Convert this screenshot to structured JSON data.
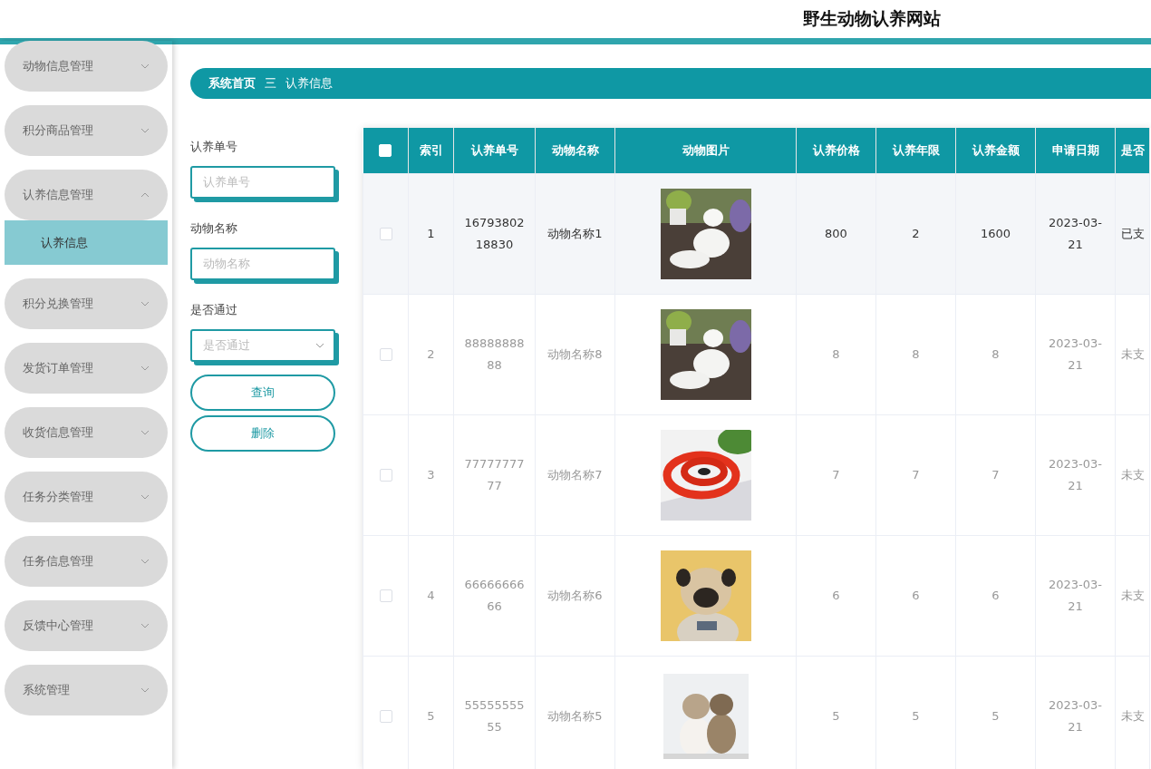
{
  "header": {
    "title": "野生动物认养网站"
  },
  "sidebar": {
    "items": [
      {
        "label": "动物信息管理",
        "expanded": false
      },
      {
        "label": "积分商品管理",
        "expanded": false
      },
      {
        "label": "认养信息管理",
        "expanded": true,
        "children": [
          {
            "label": "认养信息",
            "selected": true
          }
        ]
      },
      {
        "label": "积分兑换管理",
        "expanded": false
      },
      {
        "label": "发货订单管理",
        "expanded": false
      },
      {
        "label": "收货信息管理",
        "expanded": false
      },
      {
        "label": "任务分类管理",
        "expanded": false
      },
      {
        "label": "任务信息管理",
        "expanded": false
      },
      {
        "label": "反馈中心管理",
        "expanded": false
      },
      {
        "label": "系统管理",
        "expanded": false
      }
    ]
  },
  "breadcrumb": {
    "home": "系统首页",
    "separator": "三",
    "current": "认养信息"
  },
  "filters": [
    {
      "kind": "input",
      "label": "认养单号",
      "placeholder": "认养单号"
    },
    {
      "kind": "input",
      "label": "动物名称",
      "placeholder": "动物名称"
    },
    {
      "kind": "select",
      "label": "是否通过",
      "placeholder": "是否通过"
    }
  ],
  "buttons": [
    "查询",
    "删除"
  ],
  "table": {
    "select_all_checked": false,
    "columns": [
      "索引",
      "认养单号",
      "动物名称",
      "动物图片",
      "认养价格",
      "认养年限",
      "认养金额",
      "申请日期",
      "是否"
    ],
    "rows": [
      {
        "highlighted": true,
        "checked": false,
        "cells": [
          "1",
          "16793802 18830",
          "动物名称1",
          {
            "kind": "picture"
          },
          "800",
          "2",
          "1600",
          "2023-03- 21",
          "已支"
        ]
      },
      {
        "highlighted": false,
        "checked": false,
        "cells": [
          "2",
          "88888888 88",
          "动物名称8",
          {
            "kind": "picture"
          },
          "8",
          "8",
          "8",
          "2023-03- 21",
          "未支"
        ]
      },
      {
        "highlighted": false,
        "checked": false,
        "cells": [
          "3",
          "77777777 77",
          "动物名称7",
          {
            "kind": "picture"
          },
          "7",
          "7",
          "7",
          "2023-03- 21",
          "未支"
        ]
      },
      {
        "highlighted": false,
        "checked": false,
        "cells": [
          "4",
          "66666666 66",
          "动物名称6",
          {
            "kind": "picture"
          },
          "6",
          "6",
          "6",
          "2023-03- 21",
          "未支"
        ]
      },
      {
        "highlighted": false,
        "checked": false,
        "cells": [
          "5",
          "55555555 55",
          "动物名称5",
          {
            "kind": "picture"
          },
          "5",
          "5",
          "5",
          "2023-03- 21",
          "未支"
        ]
      }
    ]
  }
}
